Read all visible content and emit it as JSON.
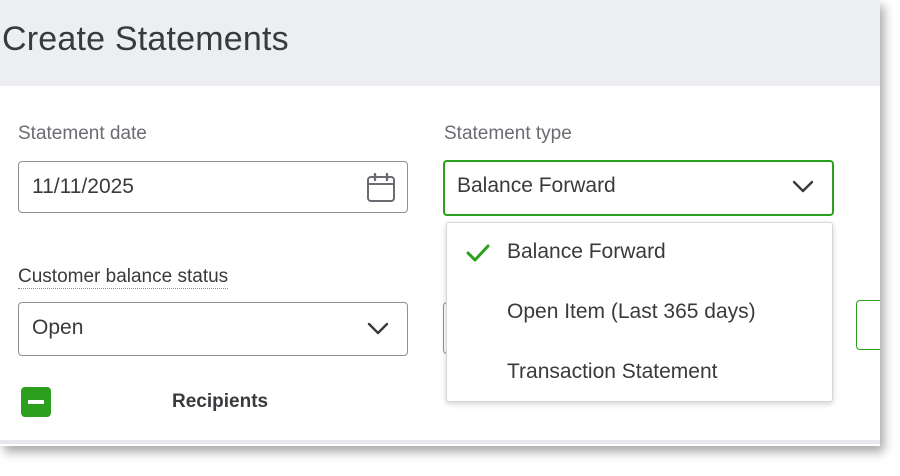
{
  "page": {
    "title": "Create Statements"
  },
  "form": {
    "statement_date": {
      "label": "Statement date",
      "value": "11/11/2025",
      "icon": "calendar-icon"
    },
    "statement_type": {
      "label": "Statement type",
      "value": "Balance Forward",
      "icon": "chevron-down-icon"
    },
    "customer_balance_status": {
      "label": "Customer balance status",
      "value": "Open",
      "icon": "chevron-down-icon"
    }
  },
  "dropdown": {
    "options": [
      {
        "label": "Balance Forward",
        "selected": true,
        "icon": "check-icon"
      },
      {
        "label": "Open Item (Last 365 days)",
        "selected": false
      },
      {
        "label": "Transaction Statement",
        "selected": false
      }
    ]
  },
  "recipients": {
    "label": "Recipients",
    "icon": "minus-icon"
  },
  "colors": {
    "accent": "#2ca01c",
    "header_bg": "#eceef1",
    "text": "#393a3d",
    "label": "#6b6c72",
    "border": "#8d9096"
  }
}
